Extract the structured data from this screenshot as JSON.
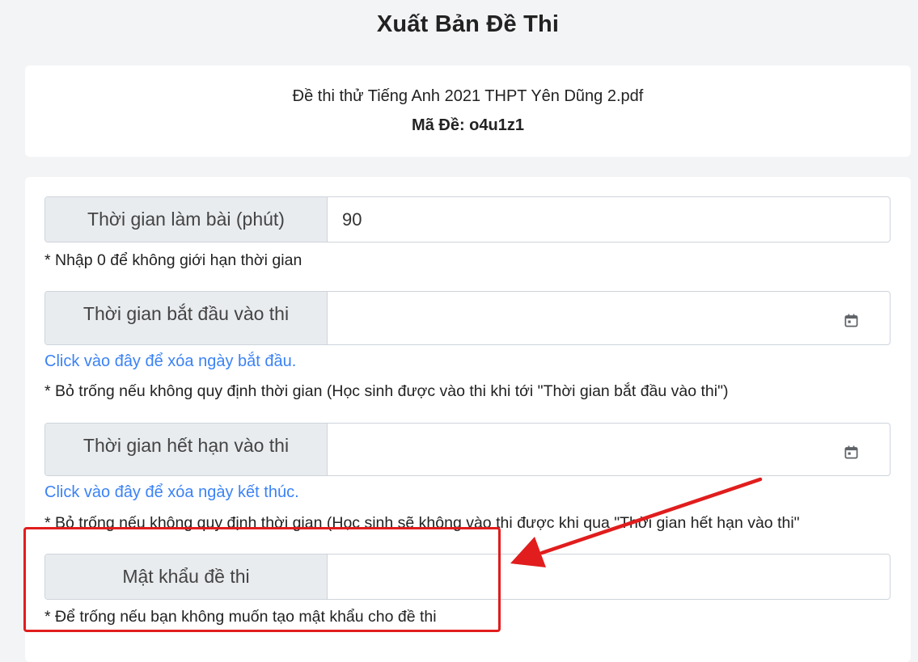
{
  "page": {
    "title": "Xuất Bản Đề Thi"
  },
  "file_info": {
    "file_name": "Đề thi thử Tiếng Anh 2021 THPT Yên Dũng 2.pdf",
    "exam_code": "Mã Đề: o4u1z1"
  },
  "form": {
    "duration": {
      "label": "Thời gian làm bài (phút)",
      "value": "90",
      "note": "* Nhập 0 để không giới hạn thời gian"
    },
    "start_time": {
      "label": "Thời gian bắt đầu vào thi",
      "value": "",
      "clear_link": "Click vào đây để xóa ngày bắt đầu.",
      "note": "* Bỏ trống nếu không quy định thời gian (Học sinh được vào thi khi tới \"Thời gian bắt đầu vào thi\")"
    },
    "end_time": {
      "label": "Thời gian hết hạn vào thi",
      "value": "",
      "clear_link": "Click vào đây để xóa ngày kết thúc.",
      "note": "* Bỏ trống nếu không quy định thời gian (Học sinh sẽ không vào thi được khi qua \"Thời gian hết hạn vào thi\""
    },
    "password": {
      "label": "Mật khẩu đề thi",
      "value": "",
      "note": "* Để trống nếu bạn không muốn tạo mật khẩu cho đề thi"
    }
  },
  "icons": {
    "calendar": "calendar-icon"
  },
  "colors": {
    "link": "#3b82f6",
    "annotation": "#e11d1d",
    "label_bg": "#e9ecef",
    "page_bg": "#f3f4f6"
  }
}
